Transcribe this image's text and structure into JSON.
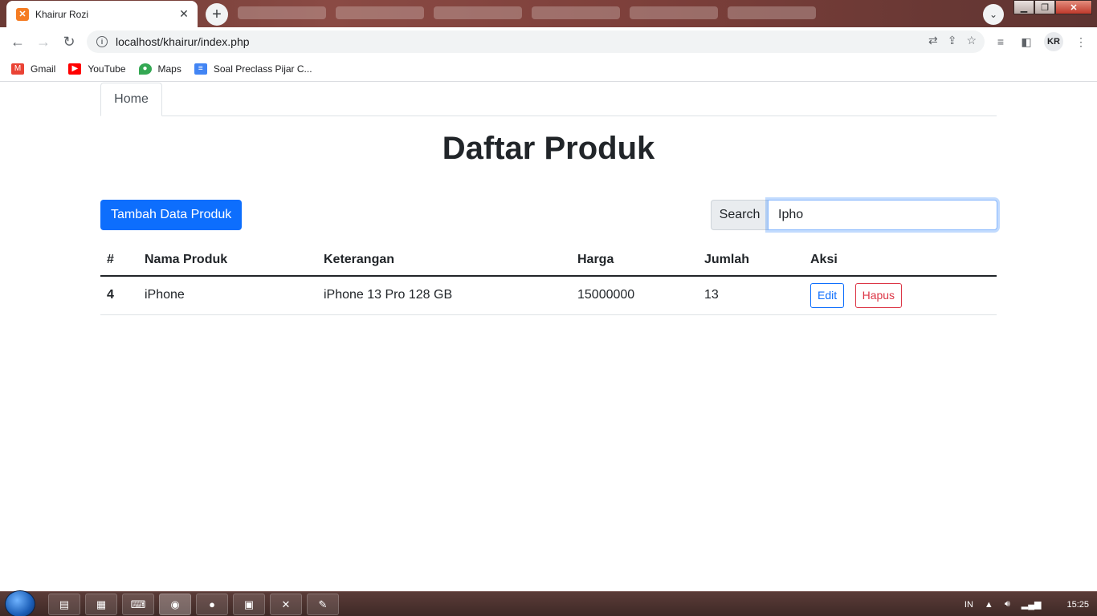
{
  "browser": {
    "tab_title": "Khairur Rozi",
    "url": "localhost/khairur/index.php",
    "profile_initials": "KR",
    "bookmarks": [
      {
        "label": "Gmail",
        "icon": "gmail-icon",
        "color": "#ea4335"
      },
      {
        "label": "YouTube",
        "icon": "youtube-icon",
        "color": "#ff0000"
      },
      {
        "label": "Maps",
        "icon": "maps-icon",
        "color": "#34a853"
      },
      {
        "label": "Soal Preclass Pijar C...",
        "icon": "docs-icon",
        "color": "#4285f4"
      }
    ]
  },
  "nav": {
    "home_label": "Home"
  },
  "page": {
    "title": "Daftar Produk",
    "add_button": "Tambah Data Produk",
    "search_label": "Search",
    "search_value": "Ipho"
  },
  "table": {
    "headers": [
      "#",
      "Nama Produk",
      "Keterangan",
      "Harga",
      "Jumlah",
      "Aksi"
    ],
    "rows": [
      {
        "id": "4",
        "name": "iPhone",
        "desc": "iPhone 13 Pro 128 GB",
        "price": "15000000",
        "qty": "13",
        "edit": "Edit",
        "delete": "Hapus"
      }
    ]
  },
  "taskbar": {
    "lang": "IN",
    "time": "15:25"
  },
  "colors": {
    "primary": "#0d6efd",
    "danger": "#dc3545",
    "text": "#212529"
  }
}
